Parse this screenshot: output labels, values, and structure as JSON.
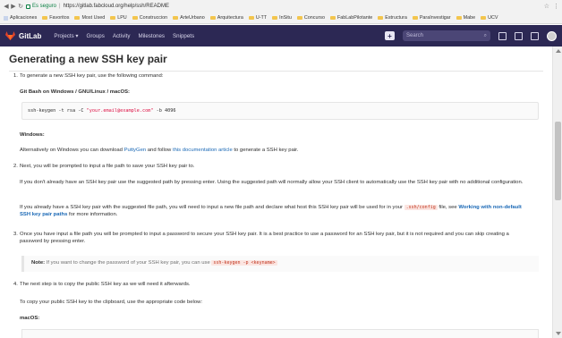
{
  "browser": {
    "secure_label": "Es seguro",
    "url": "https://gitlab.fabcloud.org/help/ssh/README",
    "bookmarks": [
      "Aplicaciones",
      "Favoritos",
      "Most Used",
      "LPU",
      "Construccion",
      "ArteUrbano",
      "Arquitectura",
      "U-TT",
      "InSitu",
      "Concurso",
      "FabLabPilotante",
      "Estructura",
      "ParaInvestigar",
      "Mabe",
      "UCV"
    ]
  },
  "gitlab_nav": {
    "brand": "GitLab",
    "links": [
      "Projects ▾",
      "Groups",
      "Activity",
      "Milestones",
      "Snippets"
    ],
    "search_placeholder": "Search"
  },
  "page": {
    "title": "Generating a new SSH key pair",
    "step1_intro": "To generate a new SSH key pair, use the following command:",
    "step1_subhead": "Git Bash on Windows / GNU/Linux / macOS:",
    "code_cmd": "ssh-keygen -t rsa -C ",
    "code_email": "\"your.email@example.com\"",
    "code_bits": " -b 4096",
    "windows_head": "Windows:",
    "windows_pre": "Alternatively on Windows you can download ",
    "windows_link1": "PuttyGen",
    "windows_mid": " and follow ",
    "windows_link2": "this documentation article",
    "windows_post": " to generate a SSH key pair.",
    "step2": "Next, you will be prompted to input a file path to save your SSH key pair to.",
    "step2_p1": "If you don't already have an SSH key pair use the suggested path by pressing enter. Using the suggested path will normally allow your SSH client to automatically use the SSH key pair with no additional configuration.",
    "step2_p2_pre": "If you already have a SSH key pair with the suggested file path, you will need to input a new file path and declare what host this SSH key pair will be used for in your ",
    "step2_p2_code": ".ssh/config",
    "step2_p2_mid": " file, see ",
    "step2_p2_link": "Working with non-default SSH key pair paths",
    "step2_p2_post": " for more information.",
    "step3": "Once you have input a file path you will be prompted to input a password to secure your SSH key pair. It is a best practice to use a password for an SSH key pair, but it is not required and you can skip creating a password by pressing enter.",
    "note_label": "Note:",
    "note_text": " If you want to change the password of your SSH key pair, you can use ",
    "note_code": "ssh-keygen -p <keyname>",
    "step4": "The next step is to copy the public SSH key as we will need it afterwards.",
    "step4_p": "To copy your public SSH key to the clipboard, use the appropriate code below:",
    "macos_head": "macOS:",
    "nums": [
      "1.",
      "2.",
      "3.",
      "4."
    ]
  }
}
